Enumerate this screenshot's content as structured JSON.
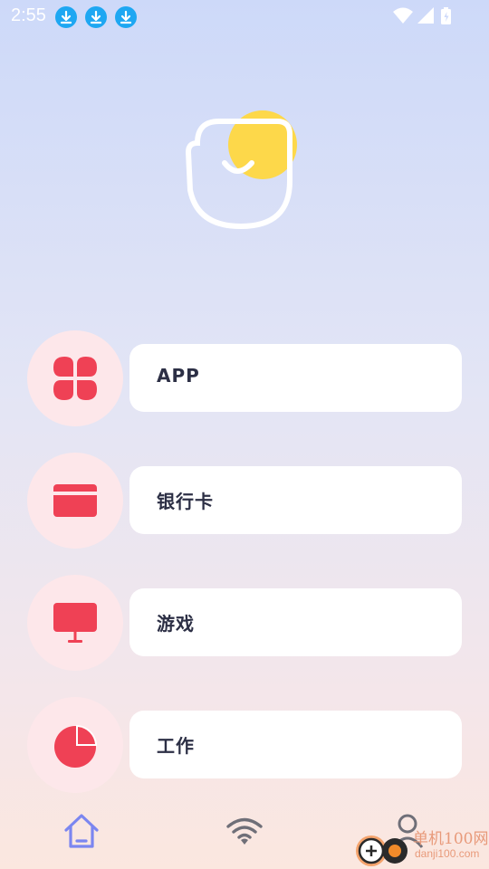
{
  "status_bar": {
    "time": "2:55",
    "notification_icons": [
      "download-icon",
      "download-icon",
      "download-icon"
    ],
    "system_icons": [
      "wifi-icon",
      "cellular-signal-icon",
      "battery-charging-icon"
    ]
  },
  "hero": {
    "icon": "smiley-shield-logo-icon",
    "accent_color": "#fdd84a"
  },
  "menu": {
    "items": [
      {
        "label": "APP",
        "icon": "app-grid-icon"
      },
      {
        "label": "银行卡",
        "icon": "bank-card-icon"
      },
      {
        "label": "游戏",
        "icon": "monitor-icon"
      },
      {
        "label": "工作",
        "icon": "pie-chart-icon"
      }
    ],
    "icon_color": "#ef4155",
    "icon_bg_color": "#fde7ea"
  },
  "bottom_nav": {
    "items": [
      {
        "name": "home",
        "icon": "home-icon",
        "active": true
      },
      {
        "name": "wifi",
        "icon": "wifi-icon",
        "active": false
      },
      {
        "name": "profile",
        "icon": "user-icon",
        "active": false
      }
    ],
    "active_color": "#7b86f0",
    "inactive_color": "#6f6f78"
  },
  "watermark": {
    "title": "单机100网",
    "subtitle": "danji100.com"
  }
}
